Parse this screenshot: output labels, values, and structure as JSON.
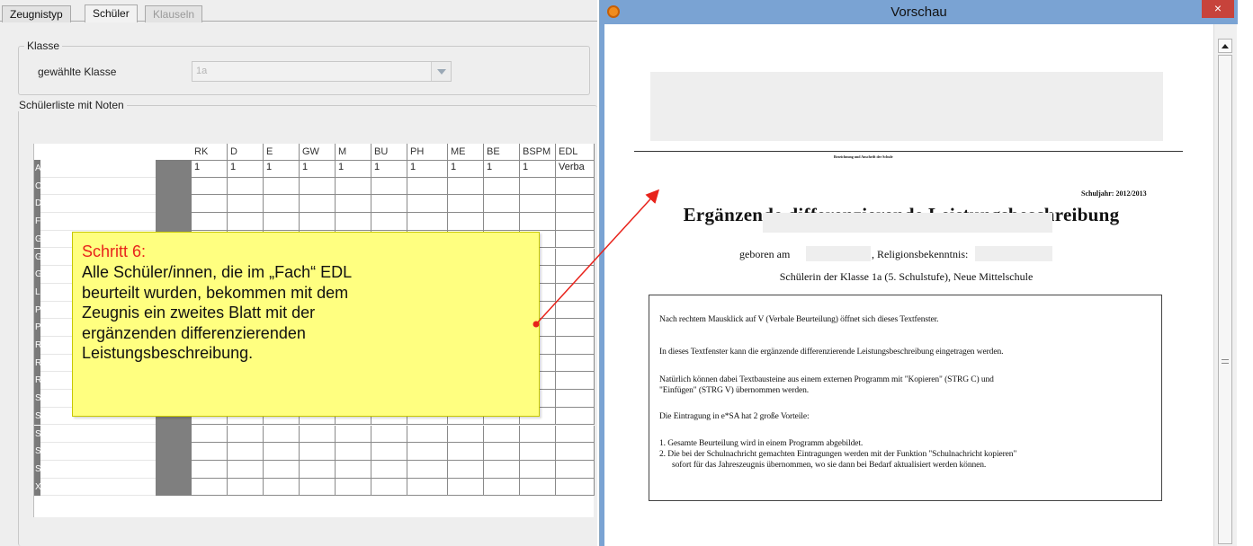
{
  "tabs": [
    {
      "label": "Zeugnistyp",
      "state": "normal"
    },
    {
      "label": "Schüler",
      "state": "active"
    },
    {
      "label": "Klauseln",
      "state": "disabled"
    }
  ],
  "klasse": {
    "group_title": "Klasse",
    "field_label": "gewählte Klasse",
    "selected_value": "1a"
  },
  "schuelerliste": {
    "group_title": "Schülerliste mit Noten",
    "columns": [
      "RK",
      "D",
      "E",
      "GW",
      "M",
      "BU",
      "PH",
      "ME",
      "BE",
      "BSPM",
      "EDL"
    ],
    "first_row_values": [
      "1",
      "1",
      "1",
      "1",
      "1",
      "1",
      "1",
      "1",
      "1",
      "1",
      "Verba"
    ],
    "row_initials": [
      "A",
      "C",
      "D",
      "F",
      "G",
      "G",
      "G",
      "L",
      "P",
      "P",
      "R",
      "R",
      "R",
      "S",
      "S",
      "S",
      "S",
      "S",
      "X"
    ]
  },
  "callout": {
    "step": "Schritt 6:",
    "lines": [
      "Alle Schüler/innen, die im „Fach“ EDL",
      "beurteilt wurden, bekommen mit dem",
      "Zeugnis ein zweites Blatt mit der",
      "ergänzenden differenzierenden",
      "Leistungsbeschreibung."
    ],
    "step_color": "#e8231b",
    "background": "#ffff80",
    "arrow_color": "#e8231b"
  },
  "preview": {
    "window_title": "Vorschau",
    "close_glyph": "×",
    "school_line": "Bezeichnung und Anschrift der Schule",
    "schuljahr": "Schuljahr: 2012/2013",
    "heading": "Ergänzende differenzierende Leistungsbeschreibung",
    "geboren_label": "geboren am",
    "religion_label": ", Religionsbekenntnis:",
    "klasse_line": "Schülerin der Klasse 1a (5. Schulstufe), Neue Mittelschule",
    "textbox_lines": [
      "Nach rechtem Mausklick auf V (Verbale Beurteilung) öffnet sich dieses Textfenster.",
      "In dieses Textfenster kann die ergänzende differenzierende Leistungsbeschreibung eingetragen werden.",
      "Natürlich können dabei Textbausteine aus einem externen Programm mit \"Kopieren\" (STRG C) und",
      "\"Einfügen\" (STRG V) übernommen werden.",
      "Die Eintragung in e*SA hat 2 große Vorteile:",
      "1. Gesamte Beurteilung wird in einem Programm abgebildet.",
      "2. Die bei der Schulnachricht gemachten Eintragungen werden mit der Funktion \"Schulnachricht kopieren\"",
      "sofort für das Jahreszeugnis übernommen, wo sie dann bei Bedarf aktualisiert werden können."
    ]
  },
  "colors": {
    "titlebar": "#7aa3d3",
    "close_button": "#c7433b",
    "panel_background": "#eeeeee",
    "row_header": "#7a7a7a"
  }
}
